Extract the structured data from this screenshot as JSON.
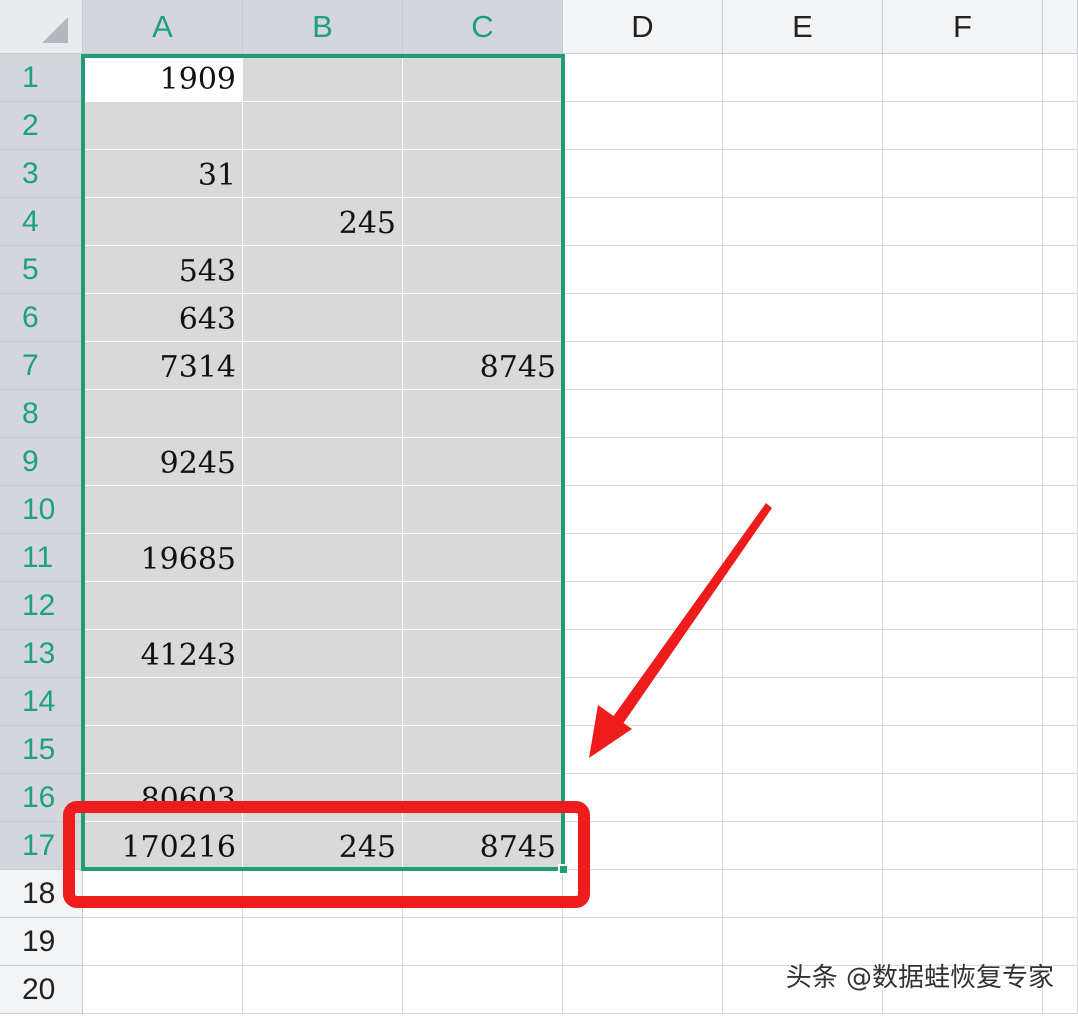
{
  "columns": [
    "A",
    "B",
    "C",
    "D",
    "E",
    "F"
  ],
  "rows": [
    "1",
    "2",
    "3",
    "4",
    "5",
    "6",
    "7",
    "8",
    "9",
    "10",
    "11",
    "12",
    "13",
    "14",
    "15",
    "16",
    "17",
    "18",
    "19",
    "20"
  ],
  "cells": {
    "A1": "1909",
    "A3": "31",
    "B4": "245",
    "A5": "543",
    "A6": "643",
    "A7": "7314",
    "C7": "8745",
    "A9": "9245",
    "A11": "19685",
    "A13": "41243",
    "A16": "80603",
    "A17": "170216",
    "B17": "245",
    "C17": "8745"
  },
  "selection": {
    "range": "A1:C17",
    "active_cell": "A1"
  },
  "colors": {
    "selection_border": "#1e9e76",
    "selected_header_text": "#1aa37a",
    "highlight_annotation": "#ee1c1c",
    "selected_fill": "#d9d9d9"
  },
  "annotations": {
    "highlight_box": "red rounded rectangle around row 17",
    "arrow": "red arrow pointing to the totals row"
  },
  "watermark": "头条 @数据蛙恢复专家"
}
